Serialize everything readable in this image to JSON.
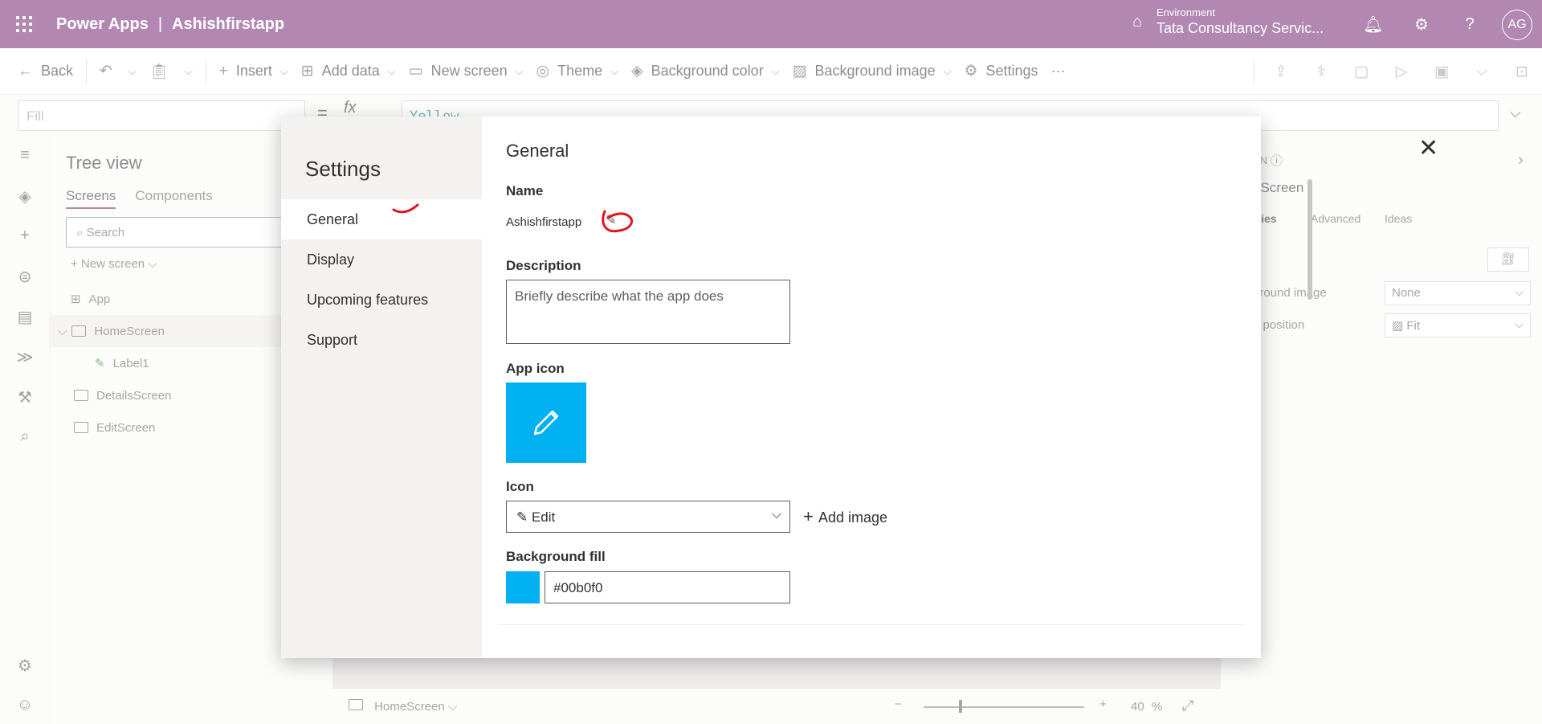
{
  "header": {
    "app_name": "Power Apps",
    "separator": "|",
    "project_name": "Ashishfirstapp",
    "environment_label": "Environment",
    "environment_value": "Tata Consultancy Servic...",
    "avatar_initials": "AG"
  },
  "toolbar": {
    "back": "Back",
    "insert": "Insert",
    "add_data": "Add data",
    "new_screen": "New screen",
    "theme": "Theme",
    "background_color": "Background color",
    "background_image": "Background image",
    "settings": "Settings",
    "more": "···"
  },
  "formula": {
    "property": "Fill",
    "equals": "=",
    "fx": "fx",
    "value": "Yellow"
  },
  "tree": {
    "title": "Tree view",
    "tabs": [
      "Screens",
      "Components"
    ],
    "search_placeholder": "Search",
    "new_screen": "New screen",
    "items": [
      "App",
      "HomeScreen",
      "Label1",
      "DetailsScreen",
      "EditScreen"
    ]
  },
  "right_panel": {
    "screen_label": "EN",
    "screen_name": "eScreen",
    "tabs": [
      "rties",
      "Advanced",
      "Ideas"
    ],
    "bg_image_label": "ground image",
    "bg_image_value": "None",
    "image_position_label": "e position",
    "image_position_value": "Fit"
  },
  "canvas": {
    "screen": "HomeScreen",
    "zoom": "40",
    "zoom_unit": "%"
  },
  "dialog": {
    "title": "Settings",
    "nav": [
      "General",
      "Display",
      "Upcoming features",
      "Support"
    ],
    "section_title": "General",
    "name_label": "Name",
    "name_value": "Ashishfirstapp",
    "description_label": "Description",
    "description_placeholder": "Briefly describe what the app does",
    "app_icon_label": "App icon",
    "icon_label": "Icon",
    "icon_value": "Edit",
    "add_image": "Add image",
    "bg_fill_label": "Background fill",
    "bg_fill_value": "#00b0f0",
    "accent_color": "#00b0f0"
  }
}
